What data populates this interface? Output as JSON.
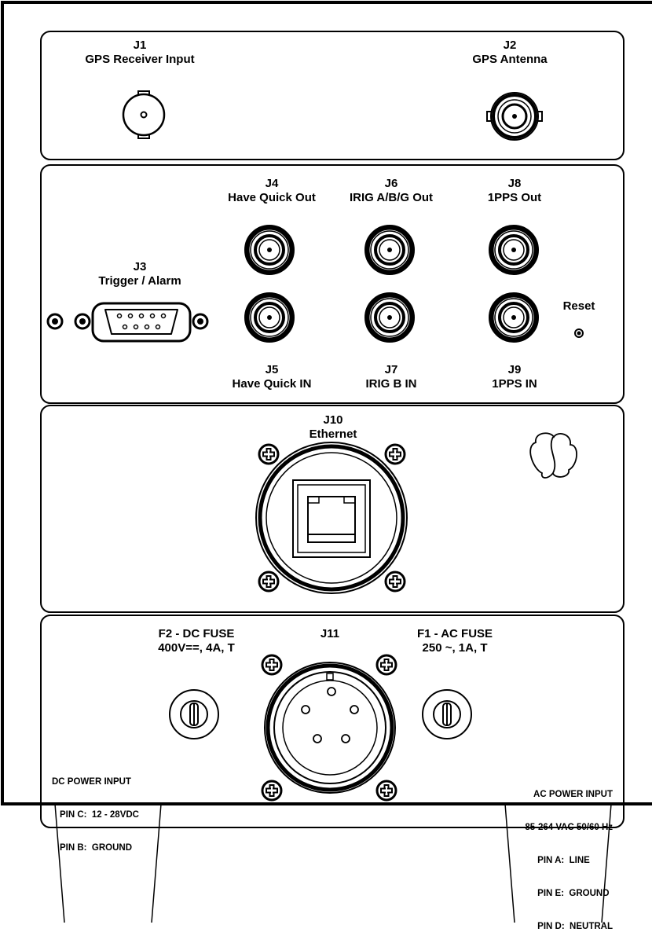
{
  "connectors": {
    "j1": {
      "id": "J1",
      "name": "GPS Receiver Input"
    },
    "j2": {
      "id": "J2",
      "name": "GPS Antenna"
    },
    "j3": {
      "id": "J3",
      "name": "Trigger / Alarm"
    },
    "j4": {
      "id": "J4",
      "name": "Have Quick Out"
    },
    "j5": {
      "id": "J5",
      "name": "Have Quick IN"
    },
    "j6": {
      "id": "J6",
      "name": "IRIG A/B/G Out"
    },
    "j7": {
      "id": "J7",
      "name": "IRIG B  IN"
    },
    "j8": {
      "id": "J8",
      "name": "1PPS Out"
    },
    "j9": {
      "id": "J9",
      "name": "1PPS IN"
    },
    "j10": {
      "id": "J10",
      "name": "Ethernet"
    },
    "j11": {
      "id": "J11"
    }
  },
  "reset": {
    "label": "Reset"
  },
  "fuses": {
    "f2": {
      "title": "F2 - DC  FUSE",
      "rating": "400V==, 4A, T"
    },
    "f1": {
      "title": "F1 - AC  FUSE",
      "rating": "250 ~, 1A, T"
    }
  },
  "dc_power": {
    "title": "DC POWER INPUT",
    "pin_c": "PIN C:  12 - 28VDC",
    "pin_b": "PIN B:  GROUND"
  },
  "ac_power": {
    "title": "AC POWER INPUT",
    "spec": "85-264 VAC 50/60 Hz",
    "pin_a": "PIN A:  LINE",
    "pin_e": "PIN E:  GROUND",
    "pin_d": "PIN D:  NEUTRAL"
  }
}
